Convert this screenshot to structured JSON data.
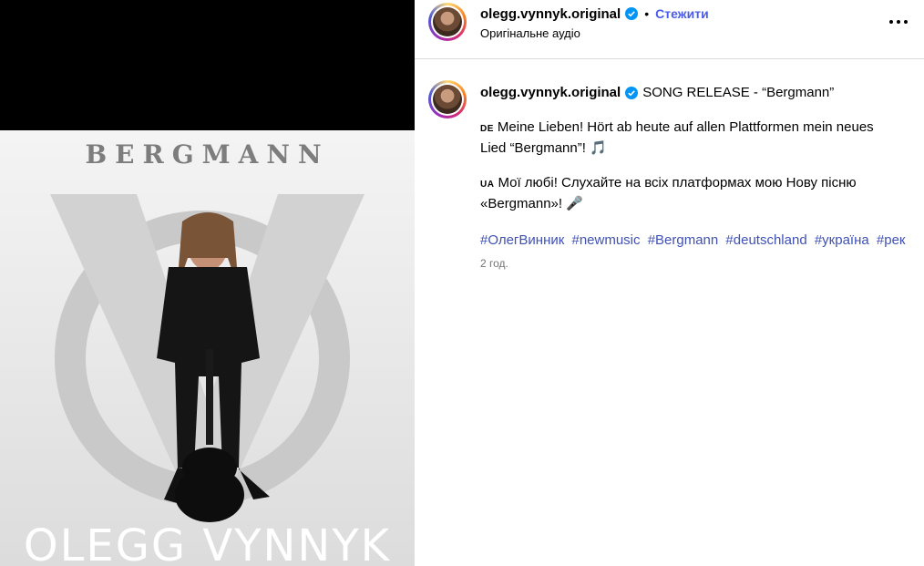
{
  "post": {
    "username": "olegg.vynnyk.original",
    "follow_label": "Стежити",
    "dot": "•",
    "audio_label": "Оригінальне аудіо",
    "more_icon": "more-horizontal-icon"
  },
  "cover": {
    "title": "BERGMANN",
    "artist": "OLEGG VYNNYK"
  },
  "caption": {
    "username": "olegg.vynnyk.original",
    "headline": "SONG RELEASE - “Bergmann”",
    "de_flag": "DE",
    "de_line1": "Meine Lieben! Hört ab heute auf allen Plattformen mein neues",
    "de_line2": "Lied “Bergmann”! 🎵",
    "ua_flag": "UA",
    "ua_line1": "Мої любі! Слухайте на всіх платформах мою Нову пісню",
    "ua_line2": "«Bergmann»! 🎤",
    "hashtags": [
      "#ОлегВинник",
      "#newmusic",
      "#Bergmann",
      "#deutschland",
      "#україна",
      "#рек"
    ],
    "time": "2 год."
  },
  "colors": {
    "accent": "#4a5de8",
    "hashtag": "#3f51b5",
    "verified": "#0095f6",
    "muted": "#737373"
  }
}
